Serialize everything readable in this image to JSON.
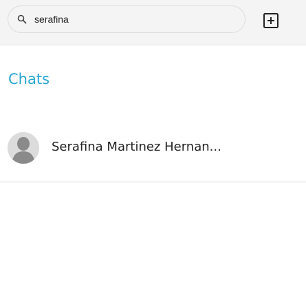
{
  "search": {
    "value": "serafina",
    "icon": "search-icon"
  },
  "toolbar": {
    "new_chat_icon": "add-box-icon"
  },
  "section": {
    "title": "Chats"
  },
  "chats": [
    {
      "name": "Serafina Martinez Hernan...",
      "avatar_icon": "user-avatar-icon"
    }
  ],
  "colors": {
    "accent": "#29a7d3",
    "topbar_bg": "#f4f4f4",
    "text": "#222222"
  }
}
